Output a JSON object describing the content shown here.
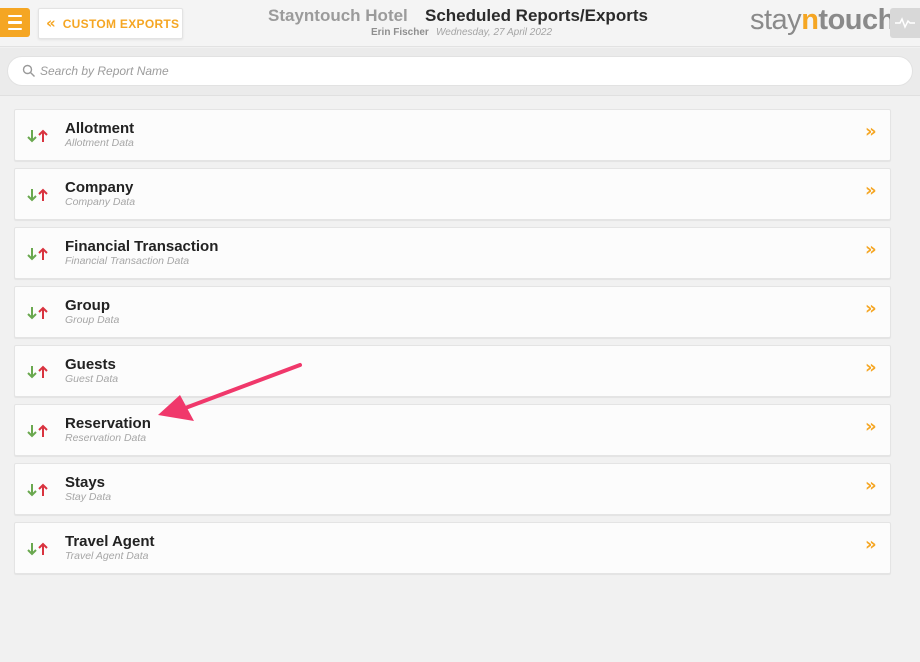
{
  "header": {
    "back_label": "CUSTOM EXPORTS",
    "hotel_name": "Stayntouch Hotel",
    "page_title": "Scheduled Reports/Exports",
    "user_name": "Erin Fischer",
    "date": "Wednesday, 27 April 2022",
    "logo_stay": "stay",
    "logo_n": "n",
    "logo_touch": "touch"
  },
  "search": {
    "placeholder": "Search by Report Name",
    "value": ""
  },
  "reports": [
    {
      "title": "Allotment",
      "subtitle": "Allotment Data"
    },
    {
      "title": "Company",
      "subtitle": "Company Data"
    },
    {
      "title": "Financial Transaction",
      "subtitle": "Financial Transaction Data"
    },
    {
      "title": "Group",
      "subtitle": "Group Data"
    },
    {
      "title": "Guests",
      "subtitle": "Guest Data"
    },
    {
      "title": "Reservation",
      "subtitle": "Reservation Data"
    },
    {
      "title": "Stays",
      "subtitle": "Stay Data"
    },
    {
      "title": "Travel Agent",
      "subtitle": "Travel Agent Data"
    }
  ],
  "icons": {
    "menu": "hamburger-icon",
    "back": "double-chevron-left-icon",
    "activity": "activity-pulse-icon",
    "search": "search-icon",
    "sort": "sort-arrows-icon",
    "go": "double-chevron-right-icon"
  },
  "colors": {
    "accent": "#f5a623",
    "sort_down": "#6aa84f",
    "sort_up": "#d9333f",
    "annotation": "#f0386b"
  }
}
